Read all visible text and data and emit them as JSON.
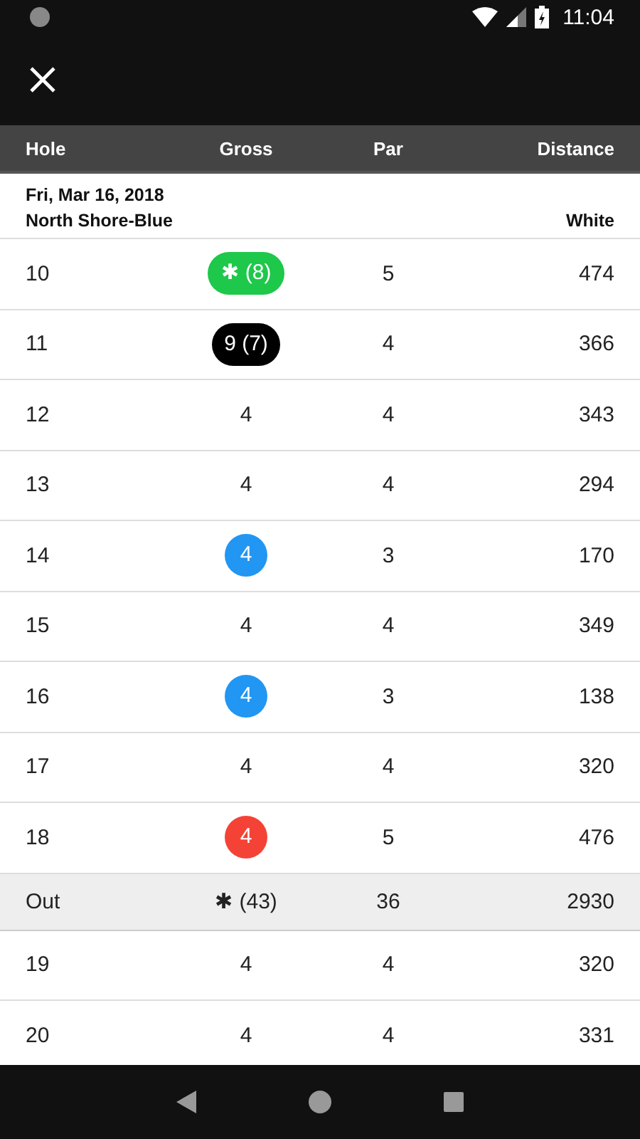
{
  "status_bar": {
    "time": "11:04"
  },
  "columns": [
    "Hole",
    "Gross",
    "Par",
    "Distance"
  ],
  "round": {
    "date": "Fri, Mar 16, 2018",
    "course": "North Shore-Blue",
    "tee": "White"
  },
  "rows": [
    {
      "kind": "hole",
      "hole": "10",
      "gross": "✱ (8)",
      "color": "#1ec84a",
      "par": "5",
      "distance": "474"
    },
    {
      "kind": "hole",
      "hole": "11",
      "gross": "9 (7)",
      "color": "#000000",
      "par": "4",
      "distance": "366"
    },
    {
      "kind": "hole",
      "hole": "12",
      "gross": "4",
      "par": "4",
      "distance": "343"
    },
    {
      "kind": "hole",
      "hole": "13",
      "gross": "4",
      "par": "4",
      "distance": "294"
    },
    {
      "kind": "hole",
      "hole": "14",
      "gross": "4",
      "color": "#2196f3",
      "par": "3",
      "distance": "170"
    },
    {
      "kind": "hole",
      "hole": "15",
      "gross": "4",
      "par": "4",
      "distance": "349"
    },
    {
      "kind": "hole",
      "hole": "16",
      "gross": "4",
      "color": "#2196f3",
      "par": "3",
      "distance": "138"
    },
    {
      "kind": "hole",
      "hole": "17",
      "gross": "4",
      "par": "4",
      "distance": "320"
    },
    {
      "kind": "hole",
      "hole": "18",
      "gross": "4",
      "color": "#f44336",
      "par": "5",
      "distance": "476"
    },
    {
      "kind": "total",
      "hole": "Out",
      "gross": "✱ (43)",
      "par": "36",
      "distance": "2930"
    },
    {
      "kind": "hole",
      "hole": "19",
      "gross": "4",
      "par": "4",
      "distance": "320"
    },
    {
      "kind": "hole",
      "hole": "20",
      "gross": "4",
      "par": "4",
      "distance": "331"
    }
  ]
}
